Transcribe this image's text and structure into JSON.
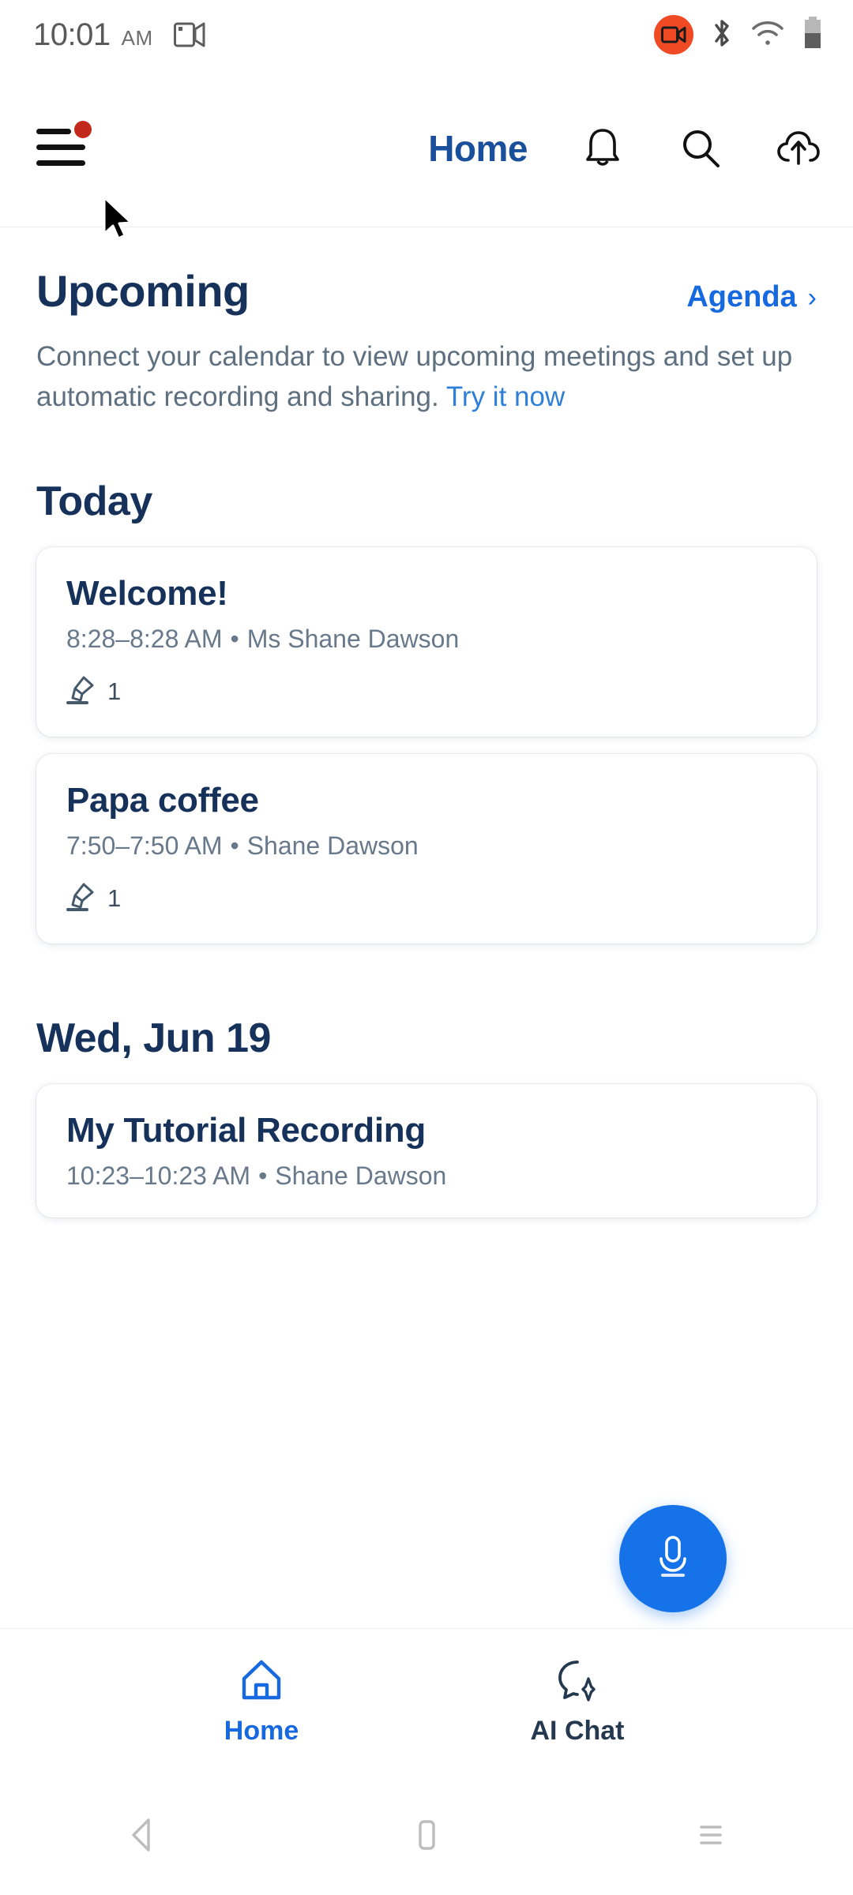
{
  "status_bar": {
    "time": "10:01",
    "ampm": "AM",
    "icons": [
      "cast-icon",
      "screen-record-icon",
      "bluetooth-icon",
      "wifi-icon",
      "battery-icon"
    ]
  },
  "header": {
    "menu_icon": "hamburger-menu-icon",
    "menu_badge": true,
    "title": "Home",
    "actions": [
      {
        "name": "notifications-icon"
      },
      {
        "name": "search-icon"
      },
      {
        "name": "cloud-upload-icon"
      }
    ]
  },
  "upcoming": {
    "title": "Upcoming",
    "link_label": "Agenda",
    "link_chevron": "›",
    "blurb_text": "Connect your calendar to view upcoming meetings and set up automatic recording and sharing. ",
    "blurb_link": "Try it now"
  },
  "sections": [
    {
      "heading": "Today",
      "cards": [
        {
          "title": "Welcome!",
          "time": "8:28–8:28 AM",
          "separator": "•",
          "host": "Ms Shane Dawson",
          "meta_icon": "highlighter-icon",
          "meta_count": "1"
        },
        {
          "title": "Papa coffee",
          "time": "7:50–7:50 AM",
          "separator": "•",
          "host": "Shane Dawson",
          "meta_icon": "highlighter-icon",
          "meta_count": "1"
        }
      ]
    },
    {
      "heading": "Wed, Jun 19",
      "cards": [
        {
          "title": "My Tutorial Recording",
          "time": "10:23–10:23 AM",
          "separator": "•",
          "host": "Shane Dawson",
          "meta_icon": null,
          "meta_count": null
        }
      ]
    }
  ],
  "fab": {
    "icon": "microphone-icon",
    "color": "#1572e8"
  },
  "bottom_nav": {
    "items": [
      {
        "label": "Home",
        "icon": "home-icon",
        "active": true
      },
      {
        "label": "AI Chat",
        "icon": "ai-chat-icon",
        "active": false
      }
    ]
  },
  "android_nav": {
    "back": "back-triangle-icon",
    "home": "home-square-icon",
    "recents": "recents-lines-icon"
  },
  "colors": {
    "accent_blue": "#1769e0",
    "navy": "#16315a",
    "muted": "#67798a",
    "record_red": "#f04a25",
    "badge_red": "#c3291a"
  }
}
